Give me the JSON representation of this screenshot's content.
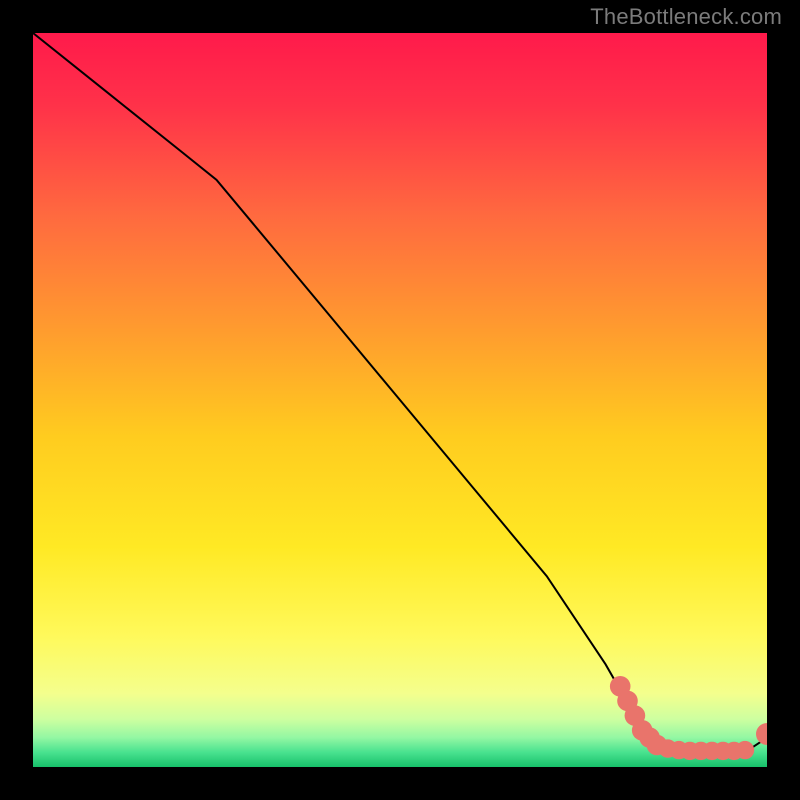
{
  "watermark": "TheBottleneck.com",
  "chart_data": {
    "type": "line",
    "title": "",
    "xlabel": "",
    "ylabel": "",
    "xlim": [
      0,
      100
    ],
    "ylim": [
      0,
      100
    ],
    "grid": false,
    "series": [
      {
        "name": "curve",
        "color": "#000000",
        "x": [
          0,
          10,
          20,
          25,
          30,
          40,
          50,
          60,
          70,
          78,
          82,
          85,
          88,
          91,
          94,
          97,
          100
        ],
        "y": [
          100,
          92,
          84,
          80,
          74,
          62,
          50,
          38,
          26,
          14,
          7,
          3,
          2,
          2,
          2,
          2,
          4
        ]
      }
    ],
    "markers": [
      {
        "x": 80,
        "y": 11,
        "r": 2.8,
        "color": "#e9746b"
      },
      {
        "x": 81,
        "y": 9,
        "r": 2.8,
        "color": "#e9746b"
      },
      {
        "x": 82,
        "y": 7,
        "r": 2.8,
        "color": "#e9746b"
      },
      {
        "x": 83,
        "y": 5,
        "r": 2.8,
        "color": "#e9746b"
      },
      {
        "x": 84,
        "y": 4,
        "r": 2.8,
        "color": "#e9746b"
      },
      {
        "x": 85,
        "y": 3,
        "r": 2.8,
        "color": "#e9746b"
      },
      {
        "x": 86.5,
        "y": 2.5,
        "r": 2.5,
        "color": "#e9746b"
      },
      {
        "x": 88,
        "y": 2.3,
        "r": 2.5,
        "color": "#e9746b"
      },
      {
        "x": 89.5,
        "y": 2.2,
        "r": 2.5,
        "color": "#e9746b"
      },
      {
        "x": 91,
        "y": 2.2,
        "r": 2.5,
        "color": "#e9746b"
      },
      {
        "x": 92.5,
        "y": 2.2,
        "r": 2.5,
        "color": "#e9746b"
      },
      {
        "x": 94,
        "y": 2.2,
        "r": 2.5,
        "color": "#e9746b"
      },
      {
        "x": 95.5,
        "y": 2.2,
        "r": 2.5,
        "color": "#e9746b"
      },
      {
        "x": 97,
        "y": 2.3,
        "r": 2.5,
        "color": "#e9746b"
      },
      {
        "x": 100,
        "y": 4.5,
        "r": 3.0,
        "color": "#e9746b"
      }
    ],
    "gradient_stops": [
      {
        "offset": 0.0,
        "color": "#ff1a4b"
      },
      {
        "offset": 0.1,
        "color": "#ff3249"
      },
      {
        "offset": 0.25,
        "color": "#ff6a3f"
      },
      {
        "offset": 0.4,
        "color": "#ff9a2f"
      },
      {
        "offset": 0.55,
        "color": "#ffcc1f"
      },
      {
        "offset": 0.7,
        "color": "#ffe924"
      },
      {
        "offset": 0.82,
        "color": "#fff95a"
      },
      {
        "offset": 0.9,
        "color": "#f4ff8d"
      },
      {
        "offset": 0.935,
        "color": "#cdffa0"
      },
      {
        "offset": 0.96,
        "color": "#93f7a3"
      },
      {
        "offset": 0.98,
        "color": "#49e28f"
      },
      {
        "offset": 1.0,
        "color": "#17c06a"
      }
    ]
  }
}
